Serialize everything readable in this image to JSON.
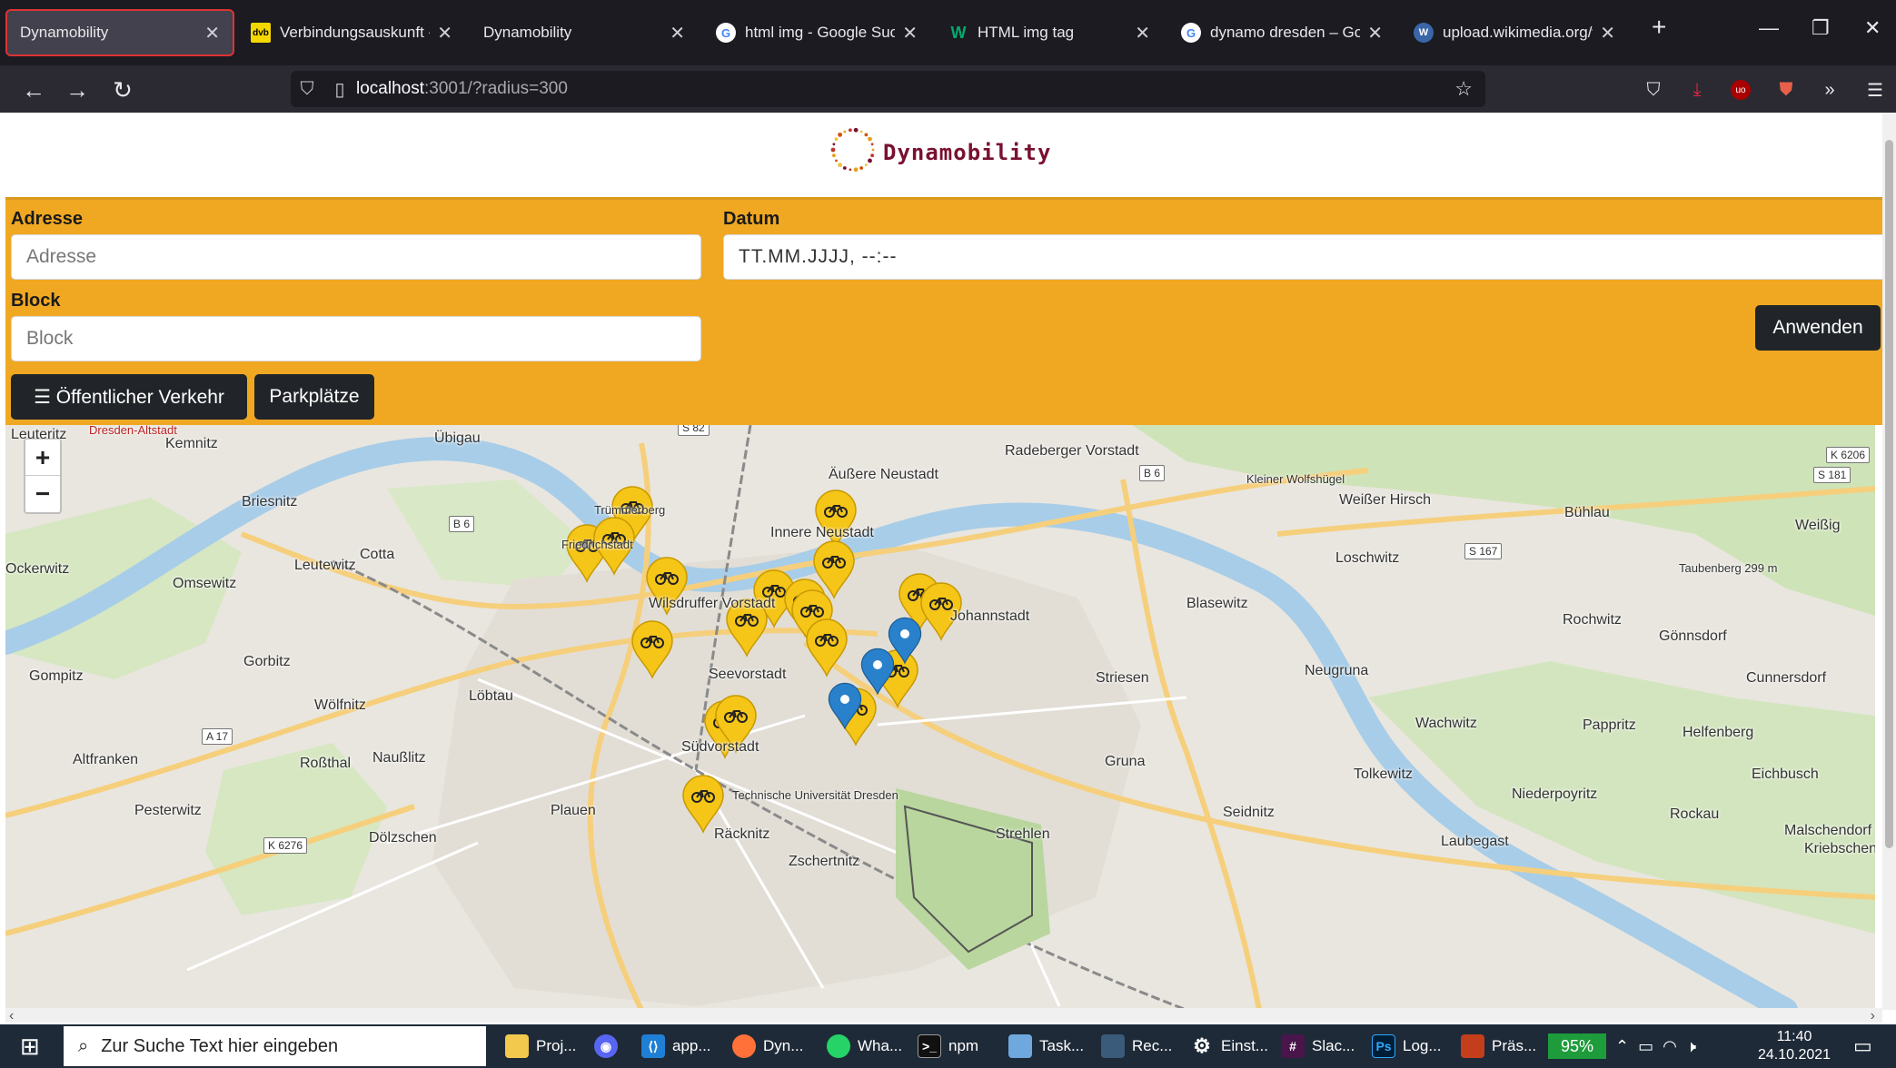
{
  "browser": {
    "tabs": [
      {
        "label": "Dynamobility",
        "active": true
      },
      {
        "label": "Verbindungsauskunft - D",
        "favicon": "dvb"
      },
      {
        "label": "Dynamobility"
      },
      {
        "label": "html img - Google Suche",
        "favicon": "G"
      },
      {
        "label": "HTML img tag",
        "favicon": "W"
      },
      {
        "label": "dynamo dresden – Goog",
        "favicon": "G"
      },
      {
        "label": "upload.wikimedia.org/w",
        "favicon": "wiki"
      }
    ],
    "url_host": "localhost",
    "url_path": ":3001/?radius=300"
  },
  "app": {
    "brand": "Dynamobility",
    "form": {
      "adresse_label": "Adresse",
      "adresse_placeholder": "Adresse",
      "datum_label": "Datum",
      "datum_placeholder": "TT.MM.JJJJ, --:--",
      "block_label": "Block",
      "block_placeholder": "Block",
      "apply_button": "Anwenden",
      "transit_button": "☰ Öffentlicher Verkehr",
      "parking_button": "Parkplätze"
    },
    "map": {
      "zoom_in": "+",
      "zoom_out": "−",
      "labels": [
        "Leuteritz",
        "Dresden-Altstadt",
        "Kemnitz",
        "Übigau",
        "Radeberger Vorstadt",
        "Äußere Neustadt",
        "Briesnitz",
        "Trümmerberg",
        "Friedrichstadt",
        "Innere Neustadt",
        "Cotta",
        "Leutewitz",
        "Ockerwitz",
        "Omsewitz",
        "Wilsdruffer Vorstadt",
        "Johannstadt",
        "Blasewitz",
        "Loschwitz",
        "Weißer Hirsch",
        "Bühlau",
        "Weißig",
        "Rochwitz",
        "Gönnsdorf",
        "Gorbitz",
        "Gompitz",
        "Seevorstadt",
        "Striesen",
        "Neugruna",
        "Löbtau",
        "Wölfnitz",
        "Altfranken",
        "Roßthal",
        "Naußlitz",
        "Südvorstadt",
        "Gruna",
        "Wachwitz",
        "Pappritz",
        "Helfenberg",
        "Cunnersdorf",
        "Tolkewitz",
        "Niederpoyritz",
        "Eichbusch",
        "Pesterwitz",
        "Plauen",
        "Seidnitz",
        "Rockau",
        "Dölzschen",
        "Räcknitz",
        "Strehlen",
        "Laubegast",
        "Malschendorf",
        "Kriebschendorf",
        "Zschertnitz",
        "Technische Universität Dresden",
        "Taubenberg 299 m",
        "Kleiner Wolfshügel"
      ],
      "roads": [
        "B 6",
        "B 6",
        "S 181",
        "K 6206",
        "S 167",
        "A 17",
        "K 6276",
        "S 82"
      ],
      "markers": {
        "bike_count": 19,
        "location_count": 3
      }
    }
  },
  "taskbar": {
    "search_placeholder": "Zur Suche Text hier eingeben",
    "apps": [
      "Proj...",
      "app...",
      "Dyn...",
      "Wha...",
      "npm",
      "Task...",
      "Rec...",
      "Einst...",
      "Slac...",
      "Log...",
      "Präs..."
    ],
    "battery": "95%",
    "time": "11:40",
    "date": "24.10.2021"
  }
}
